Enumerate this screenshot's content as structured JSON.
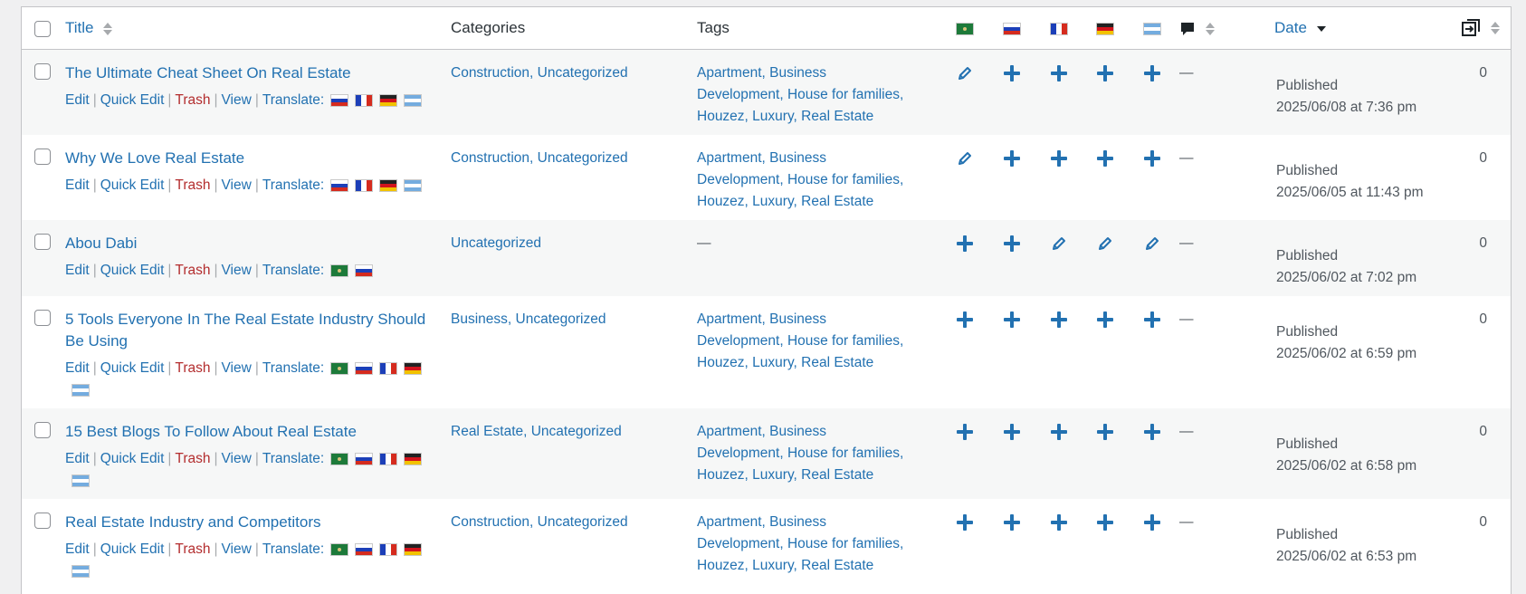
{
  "columns": {
    "title": "Title",
    "categories": "Categories",
    "tags": "Tags",
    "date": "Date"
  },
  "languages": [
    {
      "code": "ar",
      "icon": "flag-ar-icon"
    },
    {
      "code": "ru",
      "icon": "flag-ru-icon"
    },
    {
      "code": "fr",
      "icon": "flag-fr-icon"
    },
    {
      "code": "de",
      "icon": "flag-de-icon"
    },
    {
      "code": "es-ar",
      "icon": "flag-argentina-icon"
    }
  ],
  "row_actions": {
    "edit": "Edit",
    "quick_edit": "Quick Edit",
    "trash": "Trash",
    "view": "View",
    "translate": "Translate:"
  },
  "rows": [
    {
      "title": "The Ultimate Cheat Sheet On Real Estate",
      "categories": "Construction, Uncategorized",
      "tags": [
        "Apartment, Business",
        "Development, House for families,",
        "Houzez, Luxury, Real Estate"
      ],
      "translate_flags": [
        "ru",
        "fr",
        "de",
        "es-ar"
      ],
      "lang_status": [
        "pencil",
        "plus",
        "plus",
        "plus",
        "plus"
      ],
      "comments": "—",
      "status": "Published",
      "date": "2025/06/08 at 7:36 pm",
      "count": "0"
    },
    {
      "title": "Why We Love Real Estate",
      "categories": "Construction, Uncategorized",
      "tags": [
        "Apartment, Business",
        "Development, House for families,",
        "Houzez, Luxury, Real Estate"
      ],
      "translate_flags": [
        "ru",
        "fr",
        "de",
        "es-ar"
      ],
      "lang_status": [
        "pencil",
        "plus",
        "plus",
        "plus",
        "plus"
      ],
      "comments": "—",
      "status": "Published",
      "date": "2025/06/05 at 11:43 pm",
      "count": "0"
    },
    {
      "title": "Abou Dabi",
      "categories": "Uncategorized",
      "tags": [
        "—"
      ],
      "translate_flags": [
        "ar",
        "ru"
      ],
      "lang_status": [
        "plus",
        "plus",
        "pencil",
        "pencil",
        "pencil"
      ],
      "comments": "—",
      "status": "Published",
      "date": "2025/06/02 at 7:02 pm",
      "count": "0"
    },
    {
      "title": "5 Tools Everyone In The Real Estate Industry Should Be Using",
      "categories": "Business, Uncategorized",
      "tags": [
        "Apartment, Business",
        "Development, House for families,",
        "Houzez, Luxury, Real Estate"
      ],
      "translate_flags": [
        "ar",
        "ru",
        "fr",
        "de",
        "es-ar"
      ],
      "lang_status": [
        "plus",
        "plus",
        "plus",
        "plus",
        "plus"
      ],
      "comments": "—",
      "status": "Published",
      "date": "2025/06/02 at 6:59 pm",
      "count": "0"
    },
    {
      "title": "15 Best Blogs To Follow About Real Estate",
      "categories": "Real Estate, Uncategorized",
      "tags": [
        "Apartment, Business",
        "Development, House for families,",
        "Houzez, Luxury, Real Estate"
      ],
      "translate_flags": [
        "ar",
        "ru",
        "fr",
        "de",
        "es-ar"
      ],
      "lang_status": [
        "plus",
        "plus",
        "plus",
        "plus",
        "plus"
      ],
      "comments": "—",
      "status": "Published",
      "date": "2025/06/02 at 6:58 pm",
      "count": "0"
    },
    {
      "title": "Real Estate Industry and Competitors",
      "categories": "Construction, Uncategorized",
      "tags": [
        "Apartment, Business",
        "Development, House for families,",
        "Houzez, Luxury, Real Estate"
      ],
      "translate_flags": [
        "ar",
        "ru",
        "fr",
        "de",
        "es-ar"
      ],
      "lang_status": [
        "plus",
        "plus",
        "plus",
        "plus",
        "plus"
      ],
      "comments": "—",
      "status": "Published",
      "date": "2025/06/02 at 6:53 pm",
      "count": "0"
    }
  ]
}
